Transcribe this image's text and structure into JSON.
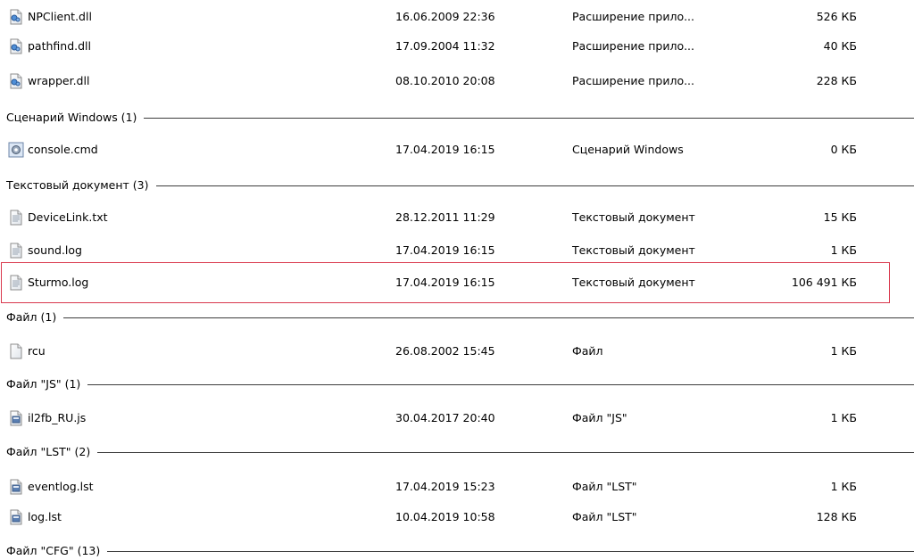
{
  "rows": {
    "npclient": {
      "name": "NPClient.dll",
      "date": "16.06.2009 22:36",
      "type": "Расширение прило...",
      "size": "526 КБ",
      "icon": "dll-file-icon"
    },
    "pathfind": {
      "name": "pathfind.dll",
      "date": "17.09.2004 11:32",
      "type": "Расширение прило...",
      "size": "40 КБ",
      "icon": "dll-file-icon"
    },
    "wrapper": {
      "name": "wrapper.dll",
      "date": "08.10.2010 20:08",
      "type": "Расширение прило...",
      "size": "228 КБ",
      "icon": "dll-file-icon"
    },
    "console": {
      "name": "console.cmd",
      "date": "17.04.2019 16:15",
      "type": "Сценарий Windows",
      "size": "0 КБ",
      "icon": "cmd-script-icon"
    },
    "devicelink": {
      "name": "DeviceLink.txt",
      "date": "28.12.2011 11:29",
      "type": "Текстовый документ",
      "size": "15 КБ",
      "icon": "text-file-icon"
    },
    "sound": {
      "name": "sound.log",
      "date": "17.04.2019 16:15",
      "type": "Текстовый документ",
      "size": "1 КБ",
      "icon": "text-file-icon"
    },
    "sturmo": {
      "name": "Sturmo.log",
      "date": "17.04.2019 16:15",
      "type": "Текстовый документ",
      "size": "106 491 КБ",
      "icon": "text-file-icon"
    },
    "rcu": {
      "name": "rcu",
      "date": "26.08.2002 15:45",
      "type": "Файл",
      "size": "1 КБ",
      "icon": "blank-file-icon"
    },
    "il2fb": {
      "name": "il2fb_RU.js",
      "date": "30.04.2017 20:40",
      "type": "Файл \"JS\"",
      "size": "1 КБ",
      "icon": "js-file-icon"
    },
    "eventlog": {
      "name": "eventlog.lst",
      "date": "17.04.2019 15:23",
      "type": "Файл \"LST\"",
      "size": "1 КБ",
      "icon": "lst-file-icon"
    },
    "loglst": {
      "name": "log.lst",
      "date": "10.04.2019 10:58",
      "type": "Файл \"LST\"",
      "size": "128 КБ",
      "icon": "lst-file-icon"
    }
  },
  "groups": {
    "windows_script": "Сценарий Windows (1)",
    "text_document": "Текстовый документ (3)",
    "file": "Файл (1)",
    "js": "Файл \"JS\" (1)",
    "lst": "Файл \"LST\" (2)",
    "cfg": "Файл \"CFG\" (13)"
  },
  "colors": {
    "selection_border": "#d9384d",
    "group_line": "#3c3c3c"
  }
}
